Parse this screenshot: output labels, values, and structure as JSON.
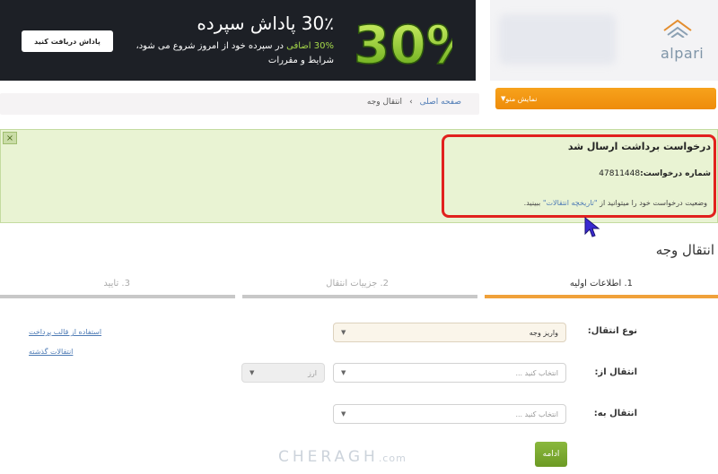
{
  "banner": {
    "button_label": "پاداش دریافت کنید",
    "title": "30٪ پاداش سپرده",
    "line1_highlight": "30% اضافی",
    "line1_rest": " در سپرده خود از امروز شروع می شود،",
    "line2": "شرایط و مقررات",
    "big_text": "30%",
    "colors": {
      "background": "#1d2026",
      "accent": "#a6d94a"
    }
  },
  "header": {
    "logo_text": "alpari",
    "menu_button_label": "نمایش منو",
    "menu_button_color": "#f39a12"
  },
  "breadcrumb": {
    "home": "صفحه اصلی",
    "separator": "›",
    "current": "انتقال وجه"
  },
  "alert": {
    "close": "×",
    "title": "درخواست برداشت ارسال شد",
    "request_label": "شماره درخواست:",
    "request_number": "47811448",
    "status_prefix": "وضعیت درخواست خود را میتوانید از ",
    "status_link": "\"تاریخچه انتقالات\"",
    "status_suffix": " ببینید."
  },
  "page": {
    "title": "انتقال وجه"
  },
  "steps": [
    {
      "label": "1. اطلاعات اولیه",
      "active": true
    },
    {
      "label": "2. جزییات انتقال",
      "active": false
    },
    {
      "label": "3. تایید",
      "active": false
    }
  ],
  "form": {
    "transfer_type_label": "نوع انتقال:",
    "transfer_type_value": "واریز وجه",
    "from_label": "انتقال از:",
    "from_placeholder": "انتخاب کنید ...",
    "currency_placeholder": "ارز",
    "to_label": "انتقال به:",
    "to_placeholder": "انتخاب کنید ...",
    "next_label": "ادامه"
  },
  "side_links": {
    "template": "استفاده از قالب پرداخت",
    "history": "انتقالات گذشته"
  },
  "watermark": {
    "text": "CHERAGH",
    "suffix": ".com"
  }
}
